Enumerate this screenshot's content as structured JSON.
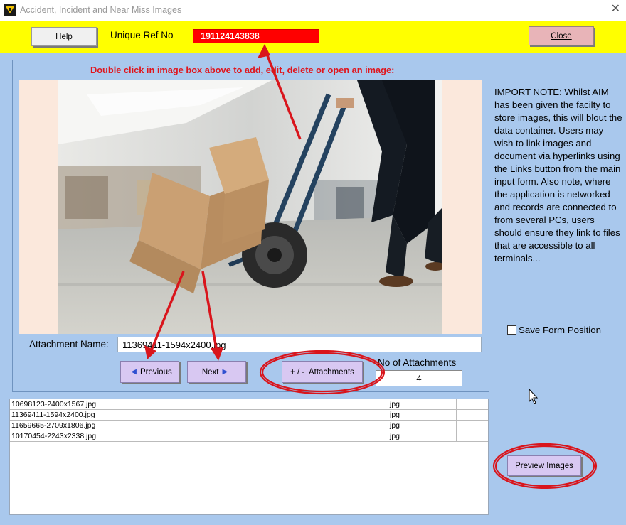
{
  "window": {
    "title": "Accident, Incident and Near Miss Images",
    "close_glyph": "✕",
    "app_icon": "app-logo-icon"
  },
  "header": {
    "help_label": "Help",
    "ref_label": "Unique Ref No",
    "ref_value": "191124143838",
    "close_label": "Close",
    "background": "#ffff00",
    "ref_highlight": "#ff0000"
  },
  "main": {
    "instruction": "Double click in image box above to add, edit, delete or open an image:",
    "attachment_label": "Attachment Name:",
    "attachment_value": "11369411-1594x2400.jpg",
    "prev_label": "Previous",
    "next_label": "Next",
    "attachments_button": "+ / -  Attachments",
    "no_attachments_label": "No of Attachments",
    "no_attachments_value": "4"
  },
  "side": {
    "note": "IMPORT NOTE:  Whilst AIM has been given the facilty to store images, this will blout the data container.  Users may wish to link images and document via hyperlinks using the Links button from the main input form.  Also note, where the application is networked and records are connected to from several PCs, users should ensure they link to files that are accessible to all terminals...",
    "save_position_label": "Save Form Position",
    "save_position_checked": false,
    "preview_label": "Preview Images"
  },
  "attachments_list": [
    {
      "name": "10698123-2400x1567.jpg",
      "ext": "jpg"
    },
    {
      "name": "11369411-1594x2400.jpg",
      "ext": "jpg"
    },
    {
      "name": "11659665-2709x1806.jpg",
      "ext": "jpg"
    },
    {
      "name": "10170454-2243x2338.jpg",
      "ext": "jpg"
    }
  ],
  "colors": {
    "background": "#a9c8ed",
    "instruction_red": "#e0151c",
    "annotation_red": "#d9151c",
    "button_purple": "#d8c8f2",
    "close_pink": "#e8b4b8"
  }
}
